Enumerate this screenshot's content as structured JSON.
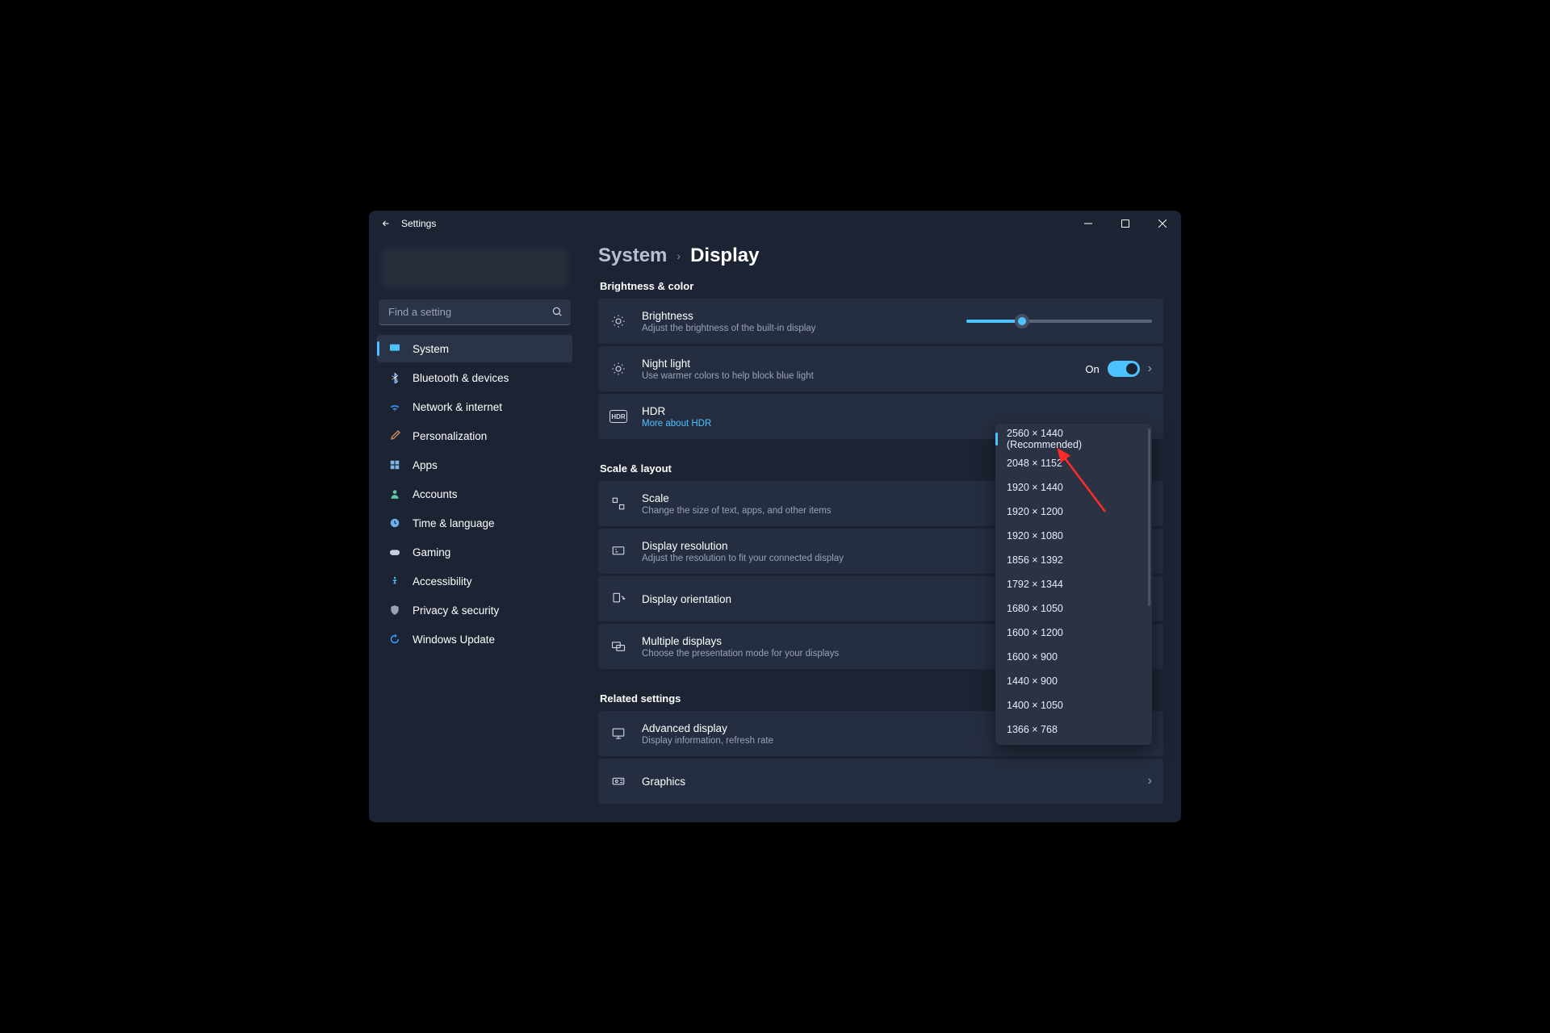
{
  "window": {
    "title": "Settings"
  },
  "search": {
    "placeholder": "Find a setting"
  },
  "sidebar": {
    "items": [
      {
        "label": "System",
        "icon": "monitor",
        "active": true
      },
      {
        "label": "Bluetooth & devices",
        "icon": "bluetooth"
      },
      {
        "label": "Network & internet",
        "icon": "wifi"
      },
      {
        "label": "Personalization",
        "icon": "brush"
      },
      {
        "label": "Apps",
        "icon": "apps"
      },
      {
        "label": "Accounts",
        "icon": "person"
      },
      {
        "label": "Time & language",
        "icon": "clock"
      },
      {
        "label": "Gaming",
        "icon": "gamepad"
      },
      {
        "label": "Accessibility",
        "icon": "access"
      },
      {
        "label": "Privacy & security",
        "icon": "shield"
      },
      {
        "label": "Windows Update",
        "icon": "update"
      }
    ]
  },
  "breadcrumb": {
    "parent": "System",
    "current": "Display"
  },
  "sections": {
    "brightness_color": "Brightness & color",
    "scale_layout": "Scale & layout",
    "related": "Related settings"
  },
  "cards": {
    "brightness": {
      "title": "Brightness",
      "sub": "Adjust the brightness of the built-in display"
    },
    "nightlight": {
      "title": "Night light",
      "sub": "Use warmer colors to help block blue light",
      "state": "On"
    },
    "hdr": {
      "title": "HDR",
      "link": "More about HDR",
      "badge": "HDR"
    },
    "scale": {
      "title": "Scale",
      "sub": "Change the size of text, apps, and other items"
    },
    "resolution": {
      "title": "Display resolution",
      "sub": "Adjust the resolution to fit your connected display"
    },
    "orientation": {
      "title": "Display orientation"
    },
    "multiple": {
      "title": "Multiple displays",
      "sub": "Choose the presentation mode for your displays"
    },
    "advanced": {
      "title": "Advanced display",
      "sub": "Display information, refresh rate"
    },
    "graphics": {
      "title": "Graphics"
    }
  },
  "resolution_dropdown": {
    "selected": "2560 × 1440 (Recommended)",
    "options": [
      "2560 × 1440 (Recommended)",
      "2048 × 1152",
      "1920 × 1440",
      "1920 × 1200",
      "1920 × 1080",
      "1856 × 1392",
      "1792 × 1344",
      "1680 × 1050",
      "1600 × 1200",
      "1600 × 900",
      "1440 × 900",
      "1400 × 1050",
      "1366 × 768"
    ]
  }
}
